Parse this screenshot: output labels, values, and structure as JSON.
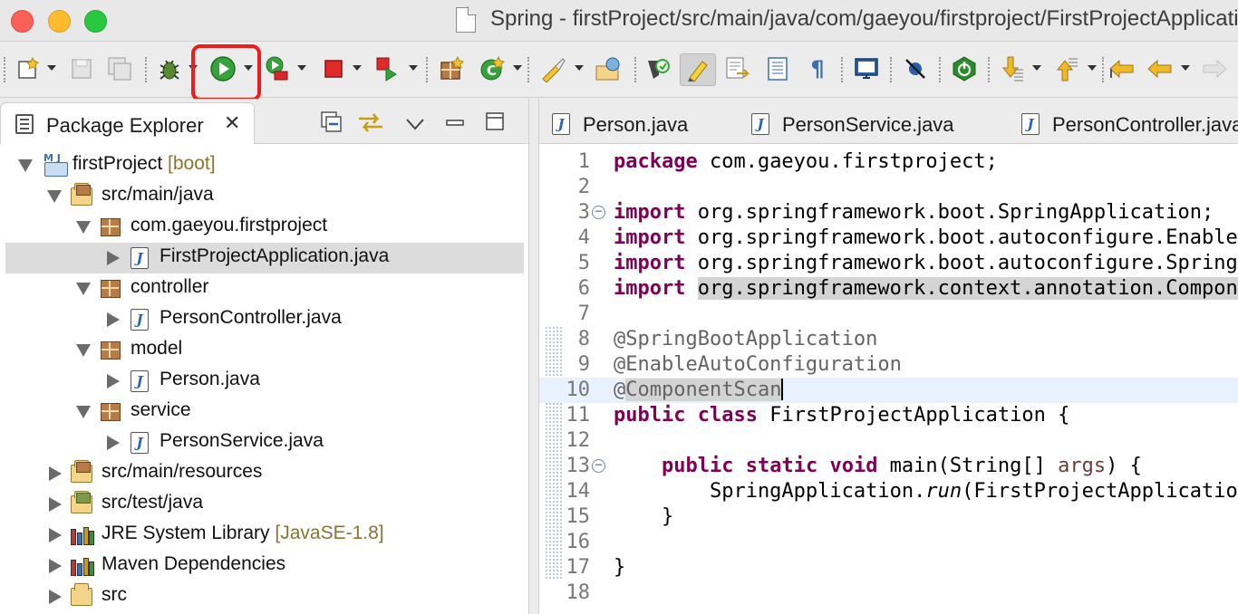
{
  "window": {
    "title": "Spring - firstProject/src/main/java/com/gaeyou/firstproject/FirstProjectApplication.java - Eclipse IDE"
  },
  "toolbar": {
    "highlighted_button": "run-button",
    "buttons": [
      "new-icon",
      "save-icon",
      "save-all-icon",
      "debug-icon",
      "run-icon",
      "run-coverage-icon",
      "terminate-icon",
      "external-tools-icon",
      "new-java-package-icon",
      "new-java-class-icon",
      "open-type-icon",
      "open-task-icon",
      "search-icon",
      "toggle-mark-occurrences-icon",
      "toggle-block-selection-icon",
      "toggle-word-wrap-icon",
      "show-whitespace-icon",
      "open-console-icon",
      "toggle-breakpoints-icon",
      "spring-boot-dashboard-icon",
      "next-annotation-icon",
      "previous-annotation-icon",
      "last-edit-icon",
      "back-icon",
      "forward-icon"
    ]
  },
  "package_explorer": {
    "title": "Package Explorer",
    "tree": [
      {
        "label": "firstProject",
        "deco": "[boot]",
        "icon": "project-icon",
        "depth": 0,
        "state": "open"
      },
      {
        "label": "src/main/java",
        "icon": "source-folder-icon",
        "depth": 1,
        "state": "open"
      },
      {
        "label": "com.gaeyou.firstproject",
        "icon": "package-icon",
        "depth": 2,
        "state": "open"
      },
      {
        "label": "FirstProjectApplication.java",
        "icon": "java-file-icon",
        "depth": 3,
        "state": "closed",
        "selected": true
      },
      {
        "label": "controller",
        "icon": "package-icon",
        "depth": 2,
        "state": "open"
      },
      {
        "label": "PersonController.java",
        "icon": "java-file-icon",
        "depth": 3,
        "state": "closed"
      },
      {
        "label": "model",
        "icon": "package-icon",
        "depth": 2,
        "state": "open"
      },
      {
        "label": "Person.java",
        "icon": "java-file-icon",
        "depth": 3,
        "state": "closed"
      },
      {
        "label": "service",
        "icon": "package-icon",
        "depth": 2,
        "state": "open"
      },
      {
        "label": "PersonService.java",
        "icon": "java-file-icon",
        "depth": 3,
        "state": "closed"
      },
      {
        "label": "src/main/resources",
        "icon": "source-folder-icon",
        "depth": 1,
        "state": "closed"
      },
      {
        "label": "src/test/java",
        "icon": "test-folder-icon",
        "depth": 1,
        "state": "closed"
      },
      {
        "label": "JRE System Library",
        "deco": "[JavaSE-1.8]",
        "icon": "library-icon",
        "depth": 1,
        "state": "closed"
      },
      {
        "label": "Maven Dependencies",
        "icon": "library-icon",
        "depth": 1,
        "state": "closed"
      },
      {
        "label": "src",
        "icon": "folder-icon",
        "depth": 1,
        "state": "closed"
      }
    ]
  },
  "editor": {
    "tabs": [
      "Person.java",
      "PersonService.java",
      "PersonController.java"
    ],
    "lines": [
      {
        "n": "1",
        "html": "<span class=\"kw\">package</span> com.gaeyou.firstproject;"
      },
      {
        "n": "2",
        "html": ""
      },
      {
        "n": "3",
        "fold": true,
        "html": "<span class=\"kw\">import</span> org.springframework.boot.SpringApplication;"
      },
      {
        "n": "4",
        "html": "<span class=\"kw\">import</span> org.springframework.boot.autoconfigure.EnableAutoConfiguration;"
      },
      {
        "n": "5",
        "html": "<span class=\"kw\">import</span> org.springframework.boot.autoconfigure.SpringBootApplication;"
      },
      {
        "n": "6",
        "html": "<span class=\"kw\">import</span> <span class=\"hl\">org.springframework.context.annotation.ComponentScan</span>;"
      },
      {
        "n": "7",
        "html": ""
      },
      {
        "n": "8",
        "html": "<span class=\"ann\">@SpringBootApplication</span>"
      },
      {
        "n": "9",
        "html": "<span class=\"ann\">@EnableAutoConfiguration</span>"
      },
      {
        "n": "10",
        "current": true,
        "html": "<span class=\"ann\">@<span class=\"hl\">ComponentScan</span></span><span class=\"caret\"></span>"
      },
      {
        "n": "11",
        "html": "<span class=\"kw\">public</span> <span class=\"kw\">class</span> FirstProjectApplication {"
      },
      {
        "n": "12",
        "html": ""
      },
      {
        "n": "13",
        "fold": true,
        "html": "    <span class=\"kw\">public</span> <span class=\"kw\">static</span> <span class=\"kw\">void</span> main(String[] <span class=\"param\">args</span>) {"
      },
      {
        "n": "14",
        "html": "        SpringApplication.<span class=\"ital\">run</span>(FirstProjectApplication.<span class=\"kw\">class</span>, <span class=\"param\">args</span>);"
      },
      {
        "n": "15",
        "html": "    }"
      },
      {
        "n": "16",
        "html": ""
      },
      {
        "n": "17",
        "html": "}"
      },
      {
        "n": "18",
        "html": ""
      }
    ]
  }
}
